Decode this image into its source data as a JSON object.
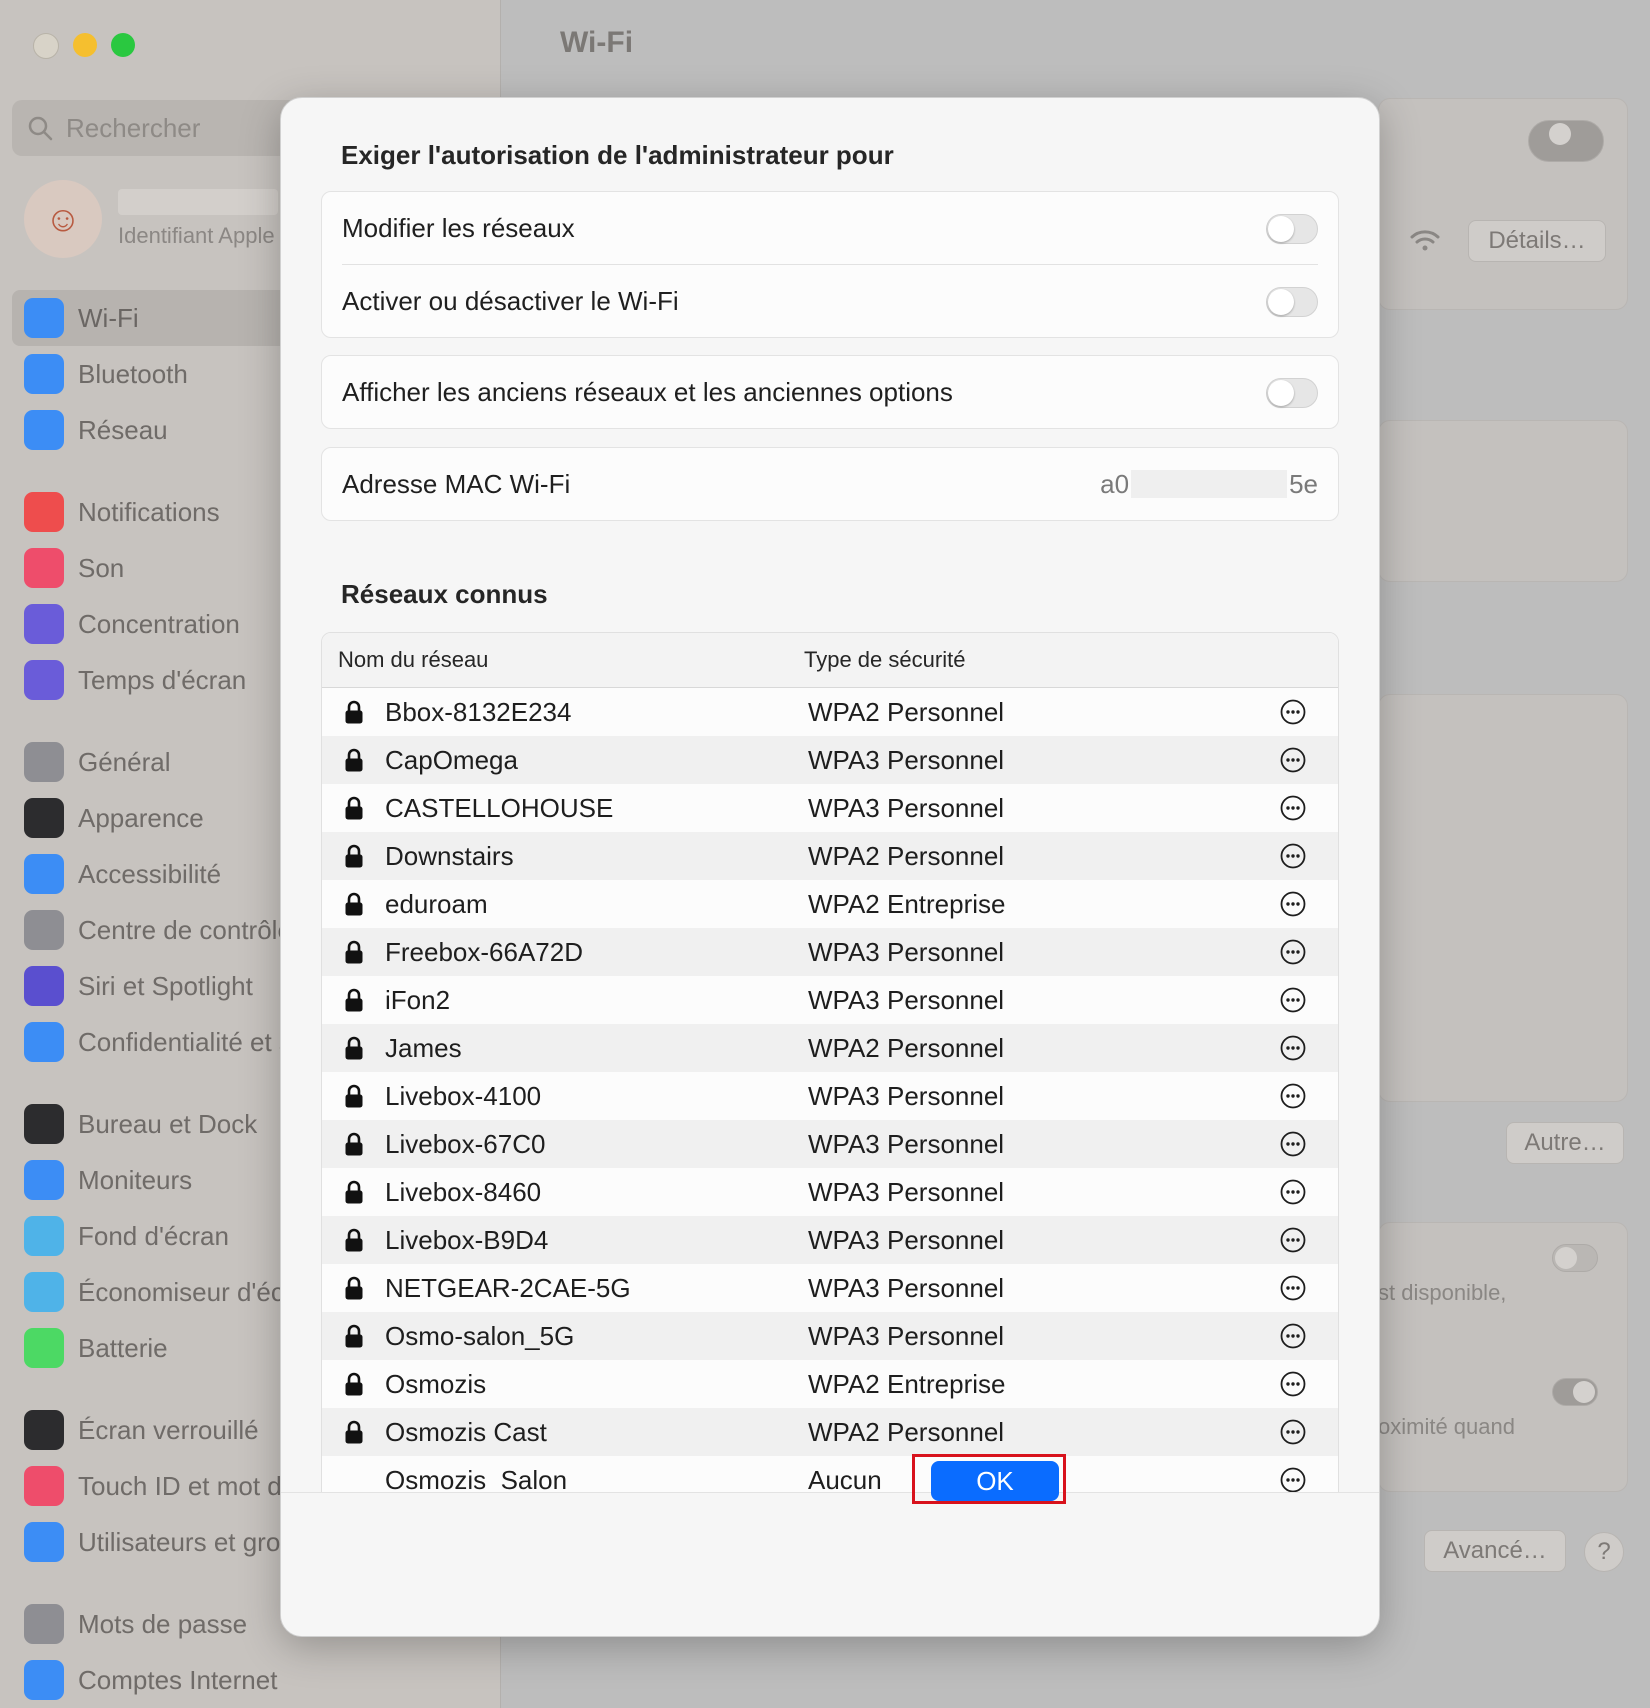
{
  "window": {
    "title": "Wi-Fi"
  },
  "sidebar": {
    "search_placeholder": "Rechercher",
    "account_subtitle": "Identifiant Apple",
    "items": [
      {
        "label": "Wi-Fi",
        "icon": "wifi-icon",
        "color": "#3c8df5",
        "active": true
      },
      {
        "label": "Bluetooth",
        "icon": "bluetooth-icon",
        "color": "#3c8df5"
      },
      {
        "label": "Réseau",
        "icon": "globe-icon",
        "color": "#3c8df5"
      },
      {
        "label": "Notifications",
        "icon": "bell-icon",
        "color": "#ee4d4d"
      },
      {
        "label": "Son",
        "icon": "speaker-icon",
        "color": "#ee4d6b"
      },
      {
        "label": "Concentration",
        "icon": "moon-icon",
        "color": "#6a5cd9"
      },
      {
        "label": "Temps d'écran",
        "icon": "hourglass-icon",
        "color": "#6a5cd9"
      },
      {
        "label": "Général",
        "icon": "gear-icon",
        "color": "#8e8e93"
      },
      {
        "label": "Apparence",
        "icon": "appearance-icon",
        "color": "#2c2c2e"
      },
      {
        "label": "Accessibilité",
        "icon": "accessibility-icon",
        "color": "#3c8df5"
      },
      {
        "label": "Centre de contrôle",
        "icon": "control-center-icon",
        "color": "#8e8e93"
      },
      {
        "label": "Siri et Spotlight",
        "icon": "siri-icon",
        "color": "#5a4fcf"
      },
      {
        "label": "Confidentialité et sécurité",
        "icon": "hand-icon",
        "color": "#3c8df5"
      },
      {
        "label": "Bureau et Dock",
        "icon": "dock-icon",
        "color": "#2c2c2e"
      },
      {
        "label": "Moniteurs",
        "icon": "sun-icon",
        "color": "#3c8df5"
      },
      {
        "label": "Fond d'écran",
        "icon": "flower-icon",
        "color": "#4fb3e8"
      },
      {
        "label": "Économiseur d'écran",
        "icon": "screensaver-icon",
        "color": "#4fb3e8"
      },
      {
        "label": "Batterie",
        "icon": "battery-icon",
        "color": "#4cd964"
      },
      {
        "label": "Écran verrouillé",
        "icon": "lock-screen-icon",
        "color": "#2c2c2e"
      },
      {
        "label": "Touch ID et mot de passe",
        "icon": "fingerprint-icon",
        "color": "#ee4d6b"
      },
      {
        "label": "Utilisateurs et groupes",
        "icon": "users-icon",
        "color": "#3c8df5"
      },
      {
        "label": "Mots de passe",
        "icon": "key-icon",
        "color": "#8e8e93"
      },
      {
        "label": "Comptes Internet",
        "icon": "at-icon",
        "color": "#3c8df5"
      }
    ]
  },
  "background": {
    "details_button": "Détails…",
    "other_button": "Autre…",
    "advanced_button": "Avancé…",
    "help_button": "?",
    "partial_text_1": "st disponible,",
    "partial_text_2": "oximité quand"
  },
  "modal": {
    "admin_title": "Exiger l'autorisation de l'administrateur pour",
    "toggle_modify_networks": "Modifier les réseaux",
    "toggle_wifi_power": "Activer ou désactiver le Wi-Fi",
    "toggle_legacy": "Afficher les anciens réseaux et les anciennes options",
    "mac_label": "Adresse MAC Wi-Fi",
    "mac_prefix": "a0",
    "mac_suffix": "5e",
    "known_title": "Réseaux connus",
    "col_name": "Nom du réseau",
    "col_security": "Type de sécurité",
    "ok_button": "OK",
    "accent_color": "#0a6cff",
    "highlight_color": "#d8121c"
  },
  "networks": [
    {
      "name": "Bbox-8132E234",
      "security": "WPA2 Personnel",
      "locked": true
    },
    {
      "name": "CapOmega",
      "security": "WPA3 Personnel",
      "locked": true
    },
    {
      "name": "CASTELLOHOUSE",
      "security": "WPA3 Personnel",
      "locked": true
    },
    {
      "name": "Downstairs",
      "security": "WPA2 Personnel",
      "locked": true
    },
    {
      "name": "eduroam",
      "security": "WPA2 Entreprise",
      "locked": true
    },
    {
      "name": "Freebox-66A72D",
      "security": "WPA3 Personnel",
      "locked": true
    },
    {
      "name": "iFon2",
      "security": "WPA3 Personnel",
      "locked": true
    },
    {
      "name": "James",
      "security": "WPA2 Personnel",
      "locked": true
    },
    {
      "name": "Livebox-4100",
      "security": "WPA3 Personnel",
      "locked": true
    },
    {
      "name": "Livebox-67C0",
      "security": "WPA3 Personnel",
      "locked": true
    },
    {
      "name": "Livebox-8460",
      "security": "WPA3 Personnel",
      "locked": true
    },
    {
      "name": "Livebox-B9D4",
      "security": "WPA3 Personnel",
      "locked": true
    },
    {
      "name": "NETGEAR-2CAE-5G",
      "security": "WPA3 Personnel",
      "locked": true
    },
    {
      "name": "Osmo-salon_5G",
      "security": "WPA3 Personnel",
      "locked": true
    },
    {
      "name": "Osmozis",
      "security": "WPA2 Entreprise",
      "locked": true
    },
    {
      "name": "Osmozis Cast",
      "security": "WPA2 Personnel",
      "locked": true
    },
    {
      "name": "Osmozis_Salon",
      "security": "Aucun",
      "locked": false
    }
  ]
}
